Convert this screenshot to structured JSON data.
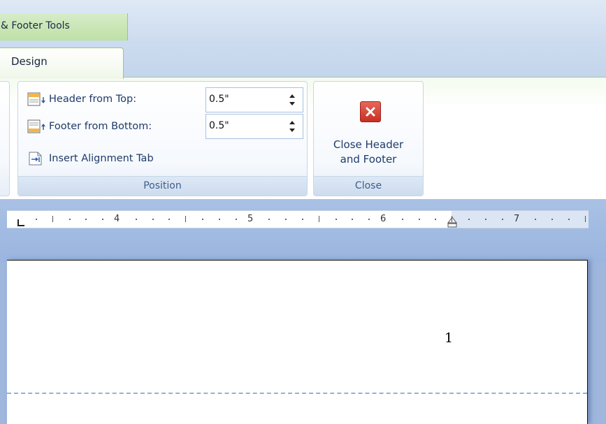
{
  "context_tab": {
    "label": "& Footer Tools"
  },
  "tabs": {
    "design_label": "Design"
  },
  "position_group": {
    "header_from_top_label": "Header from Top:",
    "header_from_top_value": "0.5\"",
    "footer_from_bottom_label": "Footer from Bottom:",
    "footer_from_bottom_value": "0.5\"",
    "insert_alignment_tab_label": "Insert Alignment Tab",
    "group_label": "Position"
  },
  "close_group": {
    "button_line1": "Close Header",
    "button_line2": "and Footer",
    "group_label": "Close"
  },
  "ruler": {
    "numbers": [
      "4",
      "5",
      "6",
      "7"
    ]
  },
  "page": {
    "number": "1"
  },
  "colors": {
    "context_green": "#c8e6b2",
    "close_red": "#d9463a",
    "ribbon_blue": "#cddcef"
  }
}
